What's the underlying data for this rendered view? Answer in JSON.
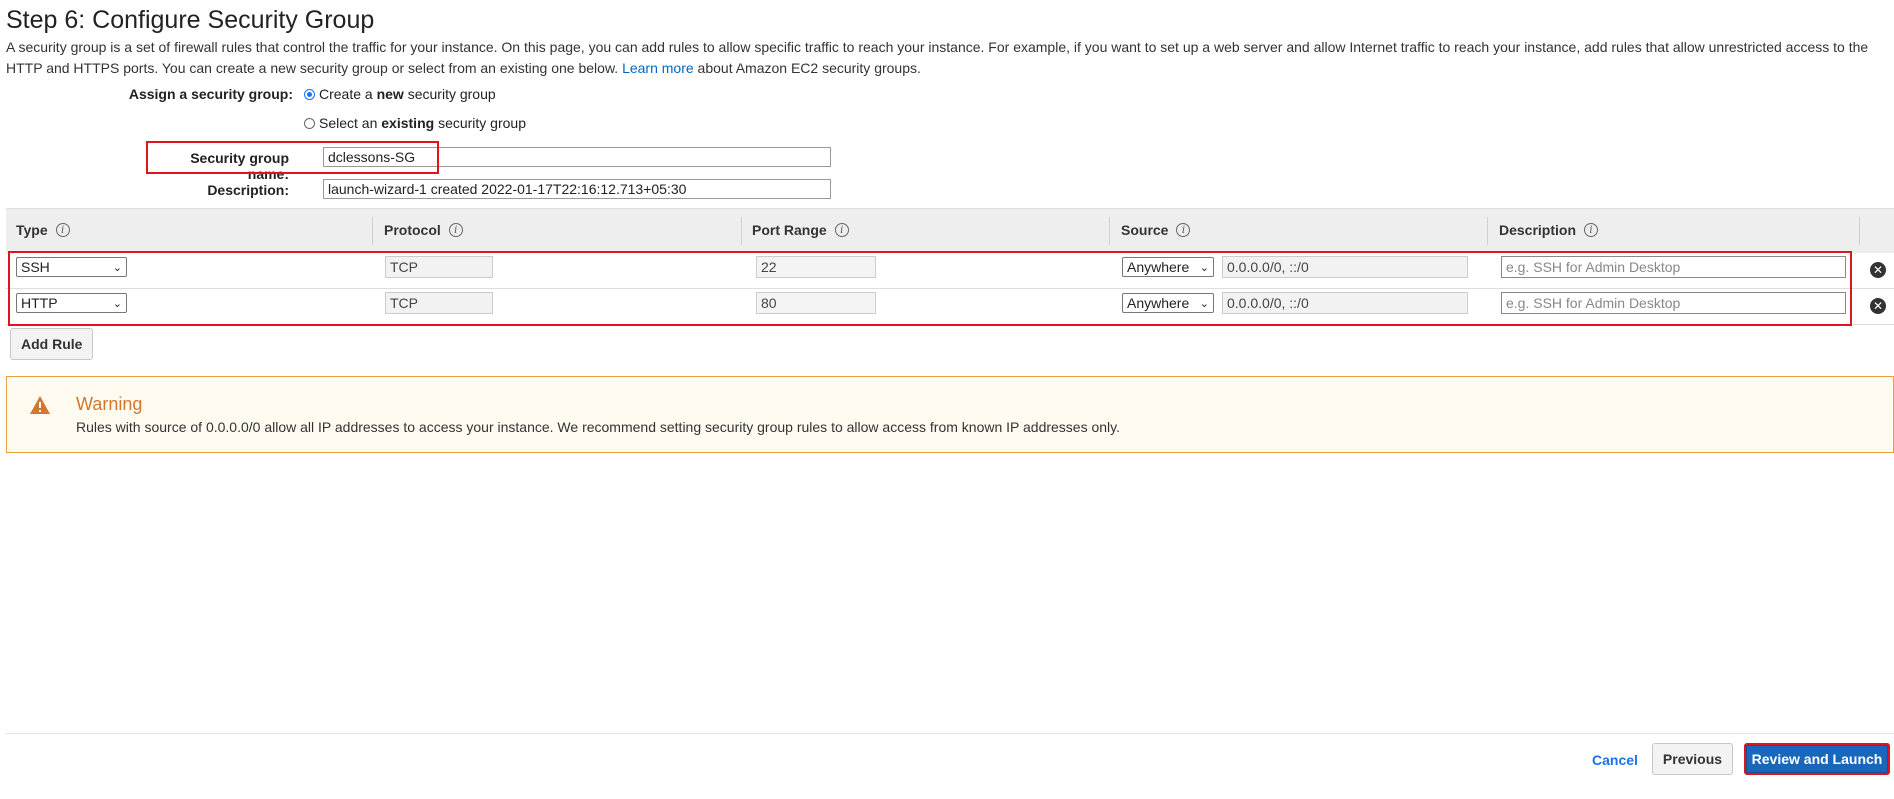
{
  "page": {
    "title": "Step 6: Configure Security Group",
    "intro_text": "A security group is a set of firewall rules that control the traffic for your instance. On this page, you can add rules to allow specific traffic to reach your instance. For example, if you want to set up a web server and allow Internet traffic to reach your instance, add rules that allow unrestricted access to the HTTP and HTTPS ports. You can create a new security group or select from an existing one below.",
    "learn_more": "Learn more",
    "intro_suffix": "about Amazon EC2 security groups."
  },
  "assign": {
    "label": "Assign a security group:",
    "option_new_pre": "Create a",
    "option_new_bold": "new",
    "option_new_post": "security group",
    "option_existing_pre": "Select an",
    "option_existing_bold": "existing",
    "option_existing_post": "security group",
    "selected": "new"
  },
  "sg": {
    "name_label": "Security group name:",
    "name_value": "dclessons-SG",
    "desc_label": "Description:",
    "desc_value": "launch-wizard-1 created 2022-01-17T22:16:12.713+05:30"
  },
  "columns": {
    "type": "Type",
    "protocol": "Protocol",
    "port_range": "Port Range",
    "source": "Source",
    "description": "Description",
    "info_glyph": "i"
  },
  "rules": [
    {
      "type": "SSH",
      "protocol": "TCP",
      "port": "22",
      "source": "Anywhere",
      "cidr": "0.0.0.0/0, ::/0",
      "desc_placeholder": "e.g. SSH for Admin Desktop"
    },
    {
      "type": "HTTP",
      "protocol": "TCP",
      "port": "80",
      "source": "Anywhere",
      "cidr": "0.0.0.0/0, ::/0",
      "desc_placeholder": "e.g. SSH for Admin Desktop"
    }
  ],
  "add_rule": "Add Rule",
  "warning": {
    "title": "Warning",
    "text": "Rules with source of 0.0.0.0/0 allow all IP addresses to access your instance. We recommend setting security group rules to allow access from known IP addresses only."
  },
  "footer": {
    "cancel": "Cancel",
    "previous": "Previous",
    "review": "Review and Launch"
  },
  "colors": {
    "accent": "#1767bd",
    "highlight": "#e0141e",
    "warning": "#d1782e"
  }
}
